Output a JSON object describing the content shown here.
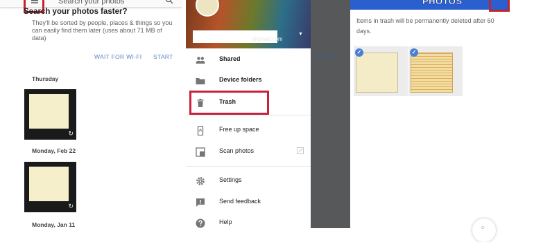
{
  "panel1": {
    "search_text": "Search your photos",
    "heading": "Search your photos faster?",
    "description": "They'll be sorted by people, places & things so you can easily find them later (uses about 71 MB of data)",
    "buttons": {
      "wait_for_wifi": "WAIT FOR WI-FI",
      "start": "START"
    },
    "groups": [
      {
        "date": "Thursday"
      },
      {
        "date": "Monday, Feb 22"
      },
      {
        "date": "Monday, Jan 11"
      }
    ],
    "sync_icon": "sync-icon"
  },
  "drawer": {
    "email_suffix": "@gmail.com",
    "items": [
      {
        "label": "Shared",
        "icon": "people-icon"
      },
      {
        "label": "Device folders",
        "icon": "folder-icon"
      },
      {
        "label": "Trash",
        "icon": "trash-icon"
      },
      {
        "label": "Free up space",
        "icon": "phone-icon"
      },
      {
        "label": "Scan photos",
        "icon": "scan-icon"
      },
      {
        "label": "Settings",
        "icon": "gear-icon"
      },
      {
        "label": "Send feedback",
        "icon": "feedback-icon"
      },
      {
        "label": "Help",
        "icon": "help-icon"
      }
    ],
    "behind_start": "START"
  },
  "trash": {
    "title": "PHOTOS",
    "notice": "Items in trash will be permanently deleted after 60 days.",
    "check_glyph": "✓"
  },
  "colors": {
    "highlight": "#c0252e",
    "accent_blue": "#2a5fcf",
    "link_blue": "#5b82c4"
  }
}
